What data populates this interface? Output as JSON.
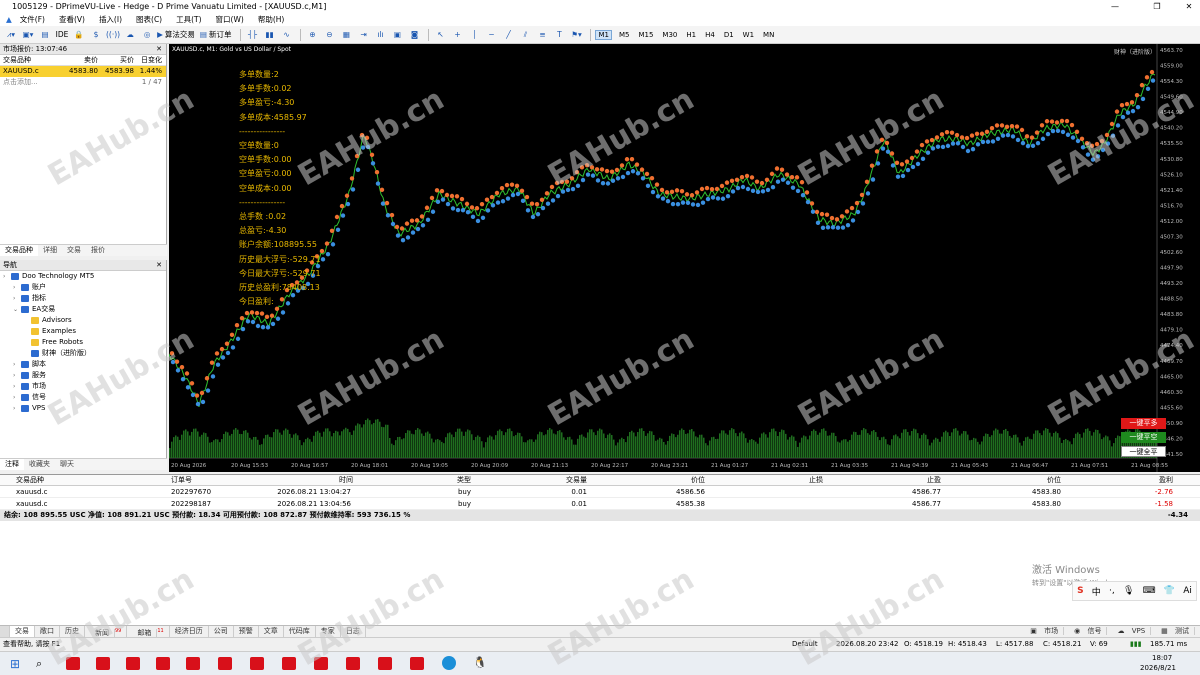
{
  "window": {
    "title": "1005129 - DPrimeVU-Live - Hedge - D Prime Vanuatu Limited - [XAUUSD.c,M1]"
  },
  "menu": [
    "文件(F)",
    "查看(V)",
    "插入(I)",
    "图表(C)",
    "工具(T)",
    "窗口(W)",
    "帮助(H)"
  ],
  "toolbar": {
    "ide": "IDE",
    "algo": "算法交易",
    "neworder": "新订单",
    "timeframes": [
      "M1",
      "M5",
      "M15",
      "M30",
      "H1",
      "H4",
      "D1",
      "W1",
      "MN"
    ],
    "active_tf": "M1"
  },
  "market_watch": {
    "title": "市场报价: 13:07:46",
    "cols": [
      "交易品种",
      "卖价",
      "买价",
      "日变化"
    ],
    "rows": [
      {
        "symbol": "XAUUSD.c",
        "bid": "4583.80",
        "ask": "4583.98",
        "change": "1.44%"
      }
    ],
    "add": "点击添加...",
    "count": "1 / 47",
    "tabs": [
      "交易品种",
      "详细",
      "交易",
      "报价"
    ]
  },
  "navigator": {
    "title": "导航",
    "items": [
      {
        "label": "Doo Technology MT5",
        "lvl": 0
      },
      {
        "label": "账户",
        "lvl": 1
      },
      {
        "label": "指标",
        "lvl": 1
      },
      {
        "label": "EA交易",
        "lvl": 1
      },
      {
        "label": "Advisors",
        "lvl": 2
      },
      {
        "label": "Examples",
        "lvl": 2
      },
      {
        "label": "Free Robots",
        "lvl": 2
      },
      {
        "label": "财神（进阶版）",
        "lvl": 2
      },
      {
        "label": "脚本",
        "lvl": 1
      },
      {
        "label": "服务",
        "lvl": 1
      },
      {
        "label": "市场",
        "lvl": 1
      },
      {
        "label": "信号",
        "lvl": 1
      },
      {
        "label": "VPS",
        "lvl": 1
      }
    ],
    "tabs": [
      "注释",
      "收藏夹",
      "聊天"
    ]
  },
  "chart": {
    "title": "XAUUSD.c, M1:  Gold vs US Dollar / Spot",
    "ea_label": "财神（进阶版）",
    "info": [
      "多单数量:2",
      "多单手数:0.02",
      "多单盈亏:-4.30",
      "多单成本:4585.97",
      "----------------",
      "空单数量:0",
      "空单手数:0.00",
      "空单盈亏:0.00",
      "空单成本:0.00",
      "----------------",
      "总手数 :0.02",
      "总盈亏:-4.30",
      "账户余额:108895.55",
      "历史最大浮亏:-529.71",
      "今日最大浮亏:-529.71",
      "历史总盈利:78408.13",
      "今日盈利:"
    ],
    "buttons": [
      "一键平多",
      "一键平空",
      "一键全平"
    ],
    "price_labels": [
      "4563.70",
      "4559.00",
      "4554.30",
      "4549.60",
      "4544.90",
      "4540.20",
      "4535.50",
      "4530.80",
      "4526.10",
      "4521.40",
      "4516.70",
      "4512.00",
      "4507.30",
      "4502.60",
      "4497.90",
      "4493.20",
      "4488.50",
      "4483.80",
      "4479.10",
      "4474.40",
      "4469.70",
      "4465.00",
      "4460.30",
      "4455.60",
      "4450.90",
      "4446.20",
      "4441.50"
    ],
    "time_labels": [
      "20 Aug 2026",
      "20 Aug 15:53",
      "20 Aug 16:57",
      "20 Aug 18:01",
      "20 Aug 19:05",
      "20 Aug 20:09",
      "20 Aug 21:13",
      "20 Aug 22:17",
      "20 Aug 23:21",
      "21 Aug 01:27",
      "21 Aug 02:31",
      "21 Aug 03:35",
      "21 Aug 04:39",
      "21 Aug 05:43",
      "21 Aug 06:47",
      "21 Aug 07:51",
      "21 Aug 08:55"
    ]
  },
  "positions": {
    "cols": [
      "交易品种",
      "订单号",
      "时间",
      "类型",
      "交易量",
      "价位",
      "止损",
      "止盈",
      "价位",
      "盈利"
    ],
    "rows": [
      {
        "symbol": "xauusd.c",
        "ticket": "202297670",
        "time": "2026.08.21 13:04:27",
        "type": "buy",
        "volume": "0.01",
        "open": "4586.56",
        "sl": "",
        "tp": "4586.77",
        "price": "4583.80",
        "profit": "-2.76"
      },
      {
        "symbol": "xauusd.c",
        "ticket": "202298187",
        "time": "2026.08.21 13:04:56",
        "type": "buy",
        "volume": "0.01",
        "open": "4585.38",
        "sl": "",
        "tp": "4586.77",
        "price": "4583.80",
        "profit": "-1.58"
      }
    ],
    "balance": "结余: 108 895.55 USC  净值: 108 891.21 USC  预付款: 18.34  可用预付款: 108 872.87  预付款维持率: 593 736.15 %",
    "total": "-4.34"
  },
  "term_tabs": [
    "交易",
    "敞口",
    "历史",
    "新闻",
    "邮箱",
    "经济日历",
    "公司",
    "预警",
    "文章",
    "代码库",
    "专家",
    "日志"
  ],
  "term_badges": {
    "news": "99",
    "mail": "11"
  },
  "right_tools": [
    "市场",
    "信号",
    "VPS",
    "测试"
  ],
  "status": {
    "help": "查看帮助, 请按 F1",
    "profile": "Default",
    "time": "2026.08.20 23:42",
    "o": "O: 4518.19",
    "h": "H: 4518.43",
    "l": "L: 4517.88",
    "c": "C: 4518.21",
    "v": "V: 69",
    "ping": "185.71 ms"
  },
  "activate": {
    "line1": "激活 Windows",
    "line2": "转到\"设置\"以激活 Windows。"
  },
  "clock": {
    "time": "18:07",
    "date": "2026/8/21"
  },
  "watermark": "EAHub.cn"
}
